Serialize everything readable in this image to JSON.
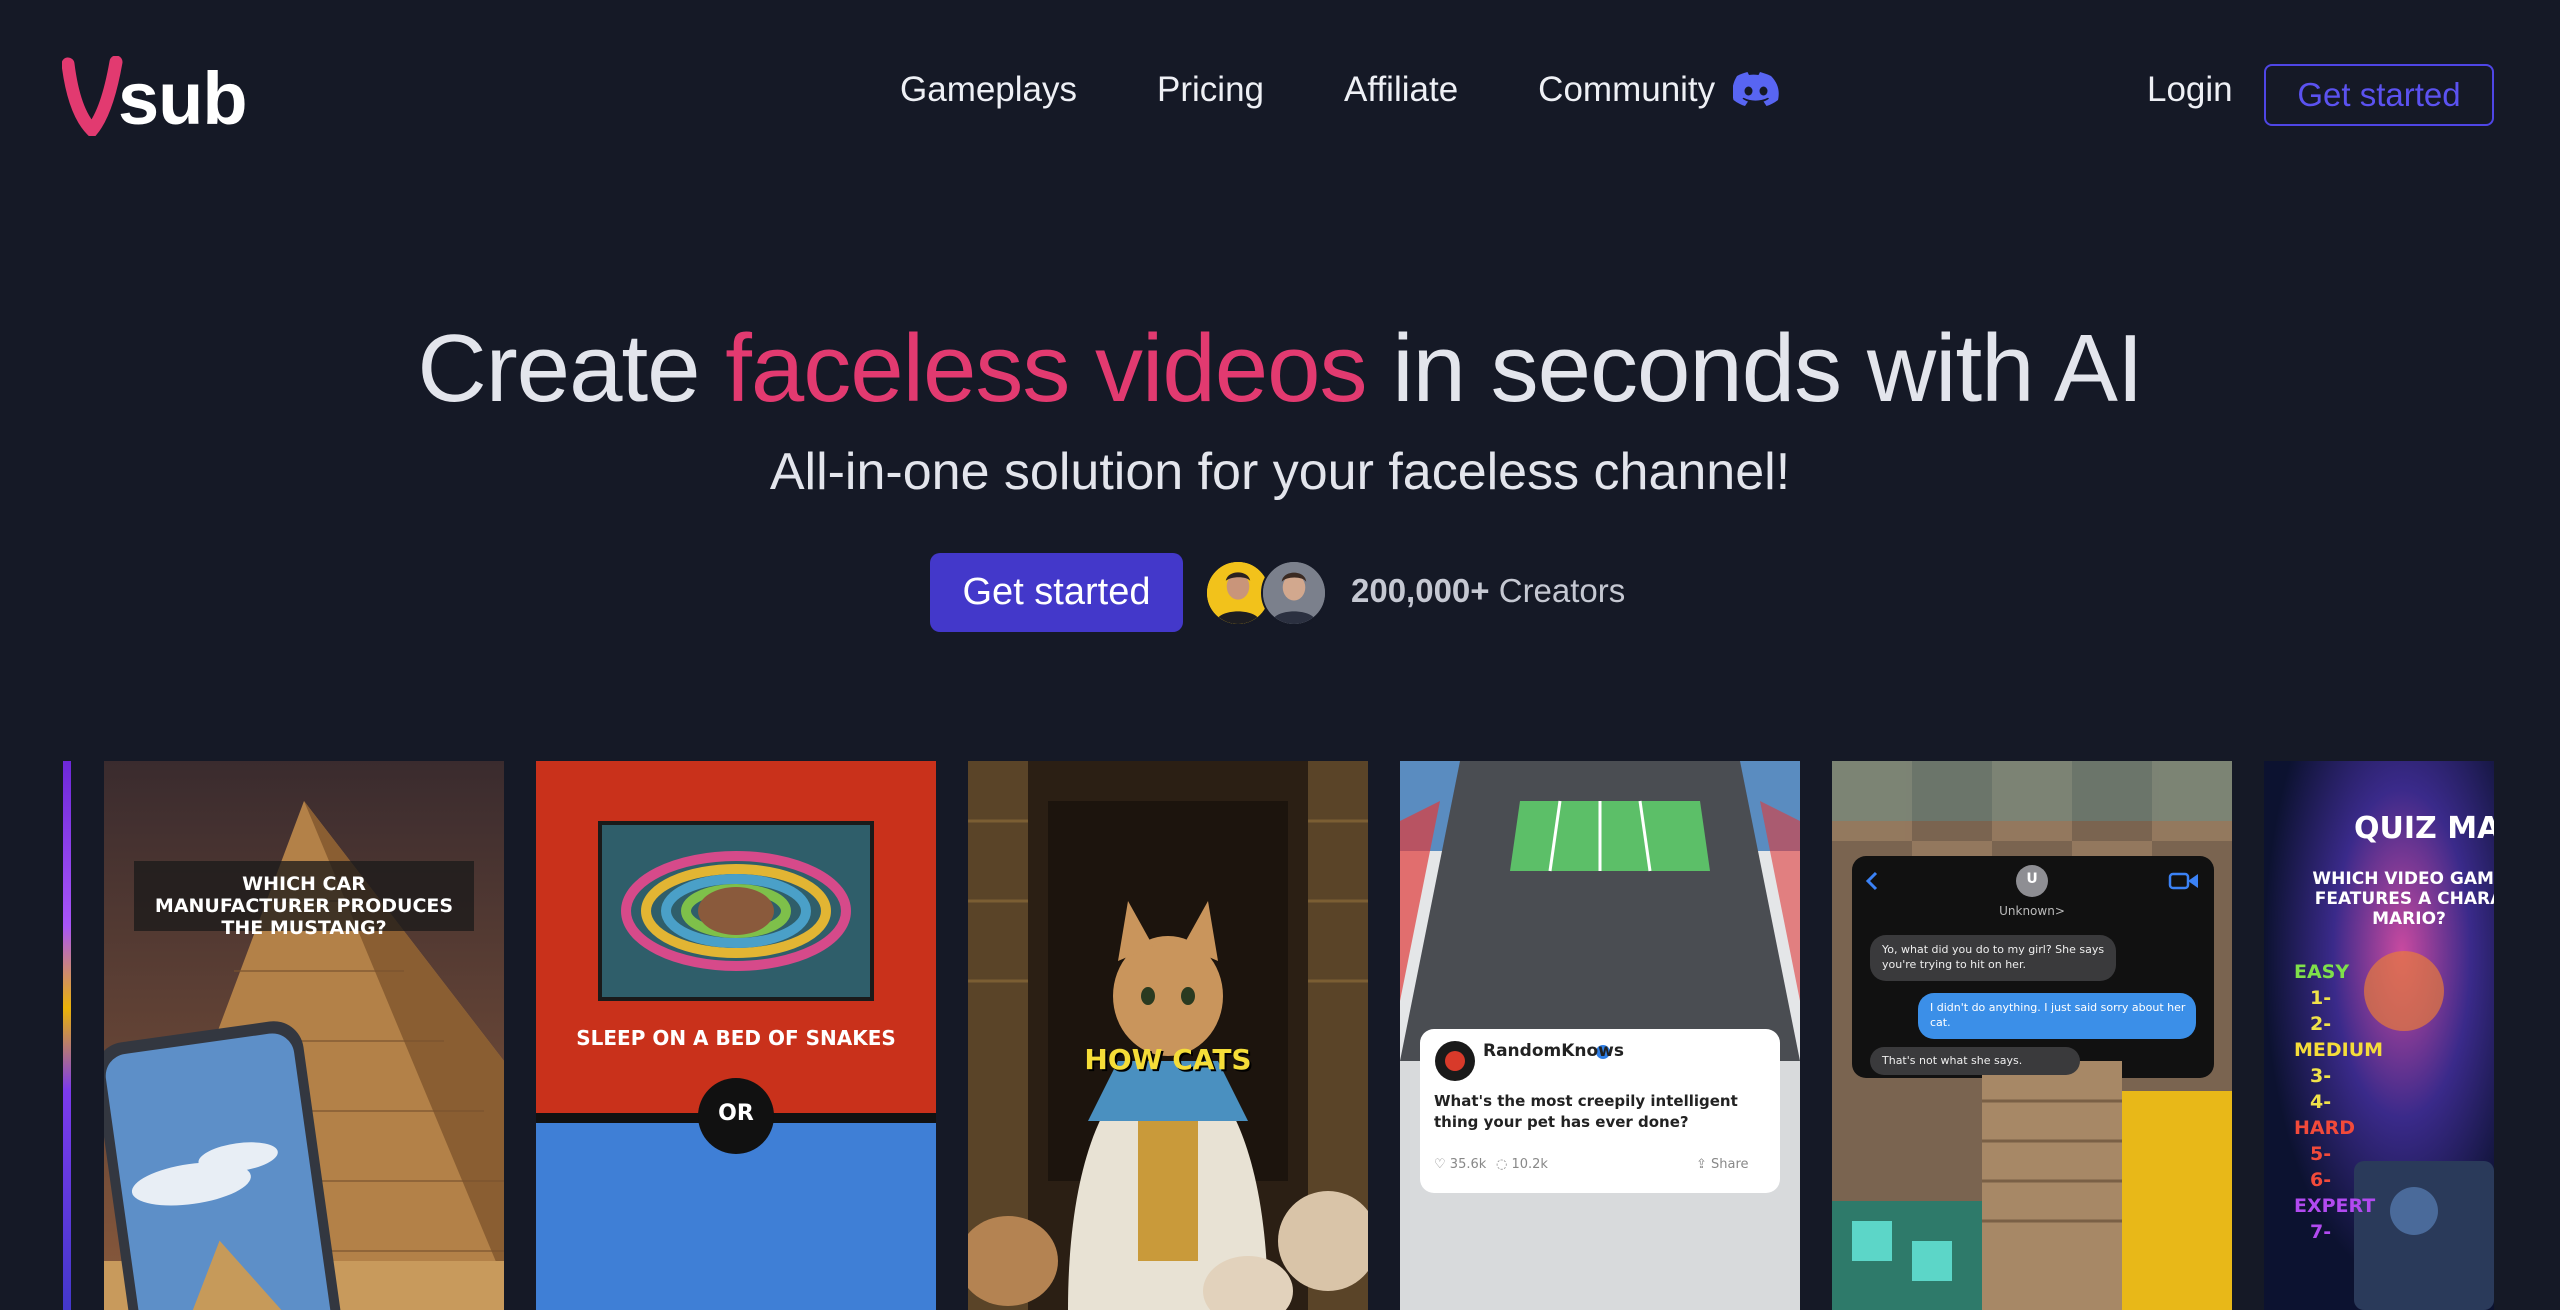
{
  "brand": {
    "logo_text": "sub",
    "accent_color": "#e23a70",
    "primary_color": "#4338ca"
  },
  "nav": {
    "items": [
      "Gameplays",
      "Pricing",
      "Affiliate",
      "Community"
    ],
    "community_icon": "discord-icon",
    "login": "Login",
    "get_started": "Get started"
  },
  "hero": {
    "title_pre": "Create ",
    "title_accent": "faceless videos",
    "title_post": " in seconds with AI",
    "subtitle": "All-in-one solution for your faceless channel!",
    "cta": "Get started",
    "creators_count": "200,000+",
    "creators_label": " Creators"
  },
  "cards": {
    "car": {
      "question": "WHICH CAR MANUFACTURER PRODUCES THE MUSTANG?"
    },
    "wyr": {
      "option1": "SLEEP ON A BED OF SNAKES",
      "or": "OR"
    },
    "cats": {
      "caption": "HOW CATS"
    },
    "reddit": {
      "user": "RandomKnows",
      "question": "What's the most creepily intelligent thing your pet has ever done?",
      "likes": "35.6k",
      "comments": "10.2k",
      "share": "Share"
    },
    "chat": {
      "avatar_letter": "U",
      "contact": "Unknown>",
      "msg1": "Yo, what did you do to my girl? She says you're trying to hit on her.",
      "msg2": "I didn't do anything. I just said sorry about her cat.",
      "msg3": "That's not what she says."
    },
    "quiz": {
      "title": "QUIZ MAS",
      "question": "WHICH VIDEO GAME FEATURES A CHARA MARIO?",
      "levels": [
        "EASY",
        "1-",
        "2-",
        "MEDIUM",
        "3-",
        "4-",
        "HARD",
        "5-",
        "6-",
        "EXPERT",
        "7-"
      ]
    }
  }
}
